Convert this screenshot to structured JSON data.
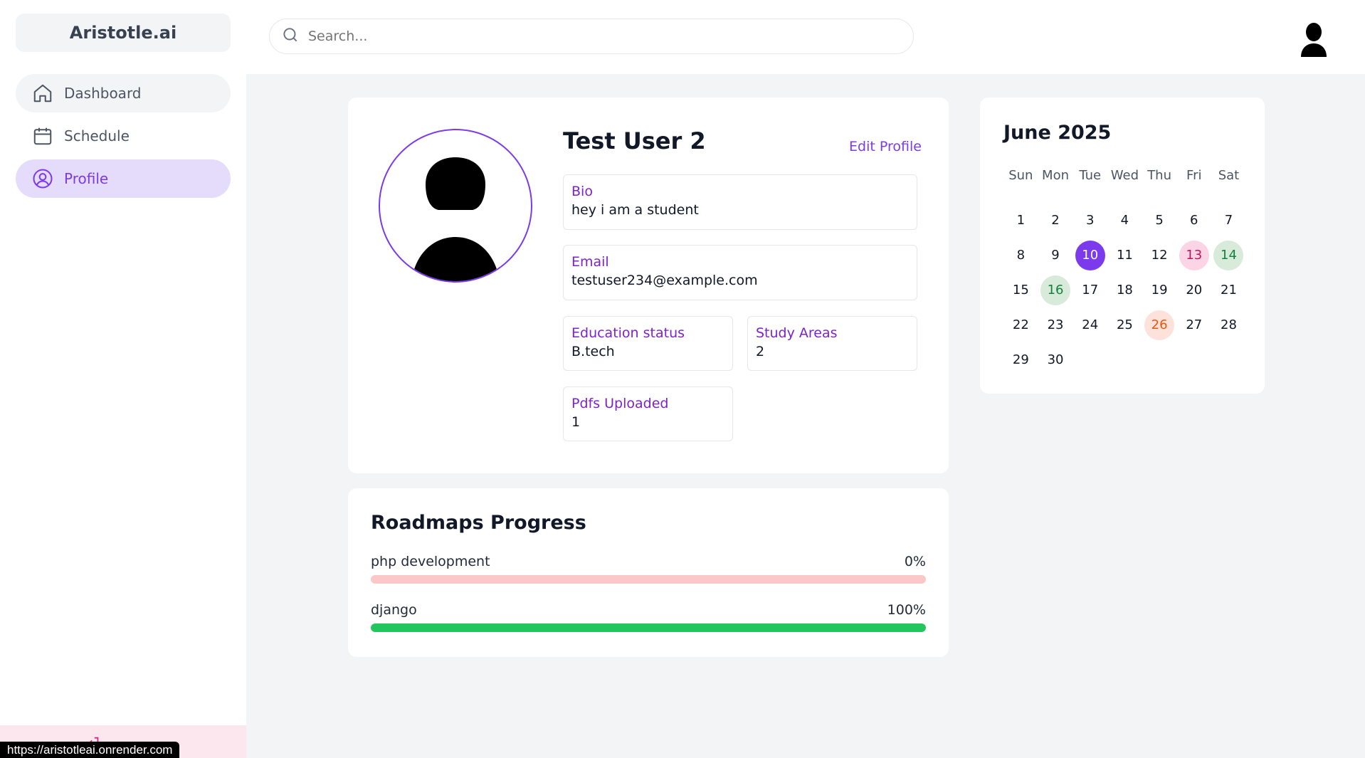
{
  "app": {
    "logo": "Aristotle.ai"
  },
  "sidebar": {
    "items": [
      {
        "label": "Dashboard",
        "icon": "home-icon"
      },
      {
        "label": "Schedule",
        "icon": "calendar-icon"
      },
      {
        "label": "Profile",
        "icon": "user-circle-icon",
        "active": true
      }
    ]
  },
  "header": {
    "search_placeholder": "Search..."
  },
  "profile": {
    "name": "Test User 2",
    "edit_label": "Edit Profile",
    "bio_label": "Bio",
    "bio": "hey i am a student",
    "email_label": "Email",
    "email": "testuser234@example.com",
    "education_label": "Education status",
    "education": "B.tech",
    "study_label": "Study Areas",
    "study": "2",
    "pdfs_label": "Pdfs Uploaded",
    "pdfs": "1"
  },
  "roadmaps": {
    "title": "Roadmaps Progress",
    "items": [
      {
        "name": "php development",
        "percent_label": "0%",
        "percent": 0
      },
      {
        "name": "django",
        "percent_label": "100%",
        "percent": 100
      }
    ]
  },
  "calendar": {
    "title": "June 2025",
    "weekdays": [
      "Sun",
      "Mon",
      "Tue",
      "Wed",
      "Thu",
      "Fri",
      "Sat"
    ],
    "days": [
      "1",
      "2",
      "3",
      "4",
      "5",
      "6",
      "7",
      "8",
      "9",
      "10",
      "11",
      "12",
      "13",
      "14",
      "15",
      "16",
      "17",
      "18",
      "19",
      "20",
      "21",
      "22",
      "23",
      "24",
      "25",
      "26",
      "27",
      "28",
      "29",
      "30"
    ],
    "today": "10",
    "highlights": {
      "13": "pink",
      "14": "green",
      "16": "green",
      "26": "orange"
    }
  },
  "status_bar": {
    "url": "https://aristotleai.onrender.com"
  },
  "colors": {
    "accent": "#7c3aed",
    "progress_complete": "#22c55e",
    "progress_empty": "#fbc7c7"
  }
}
